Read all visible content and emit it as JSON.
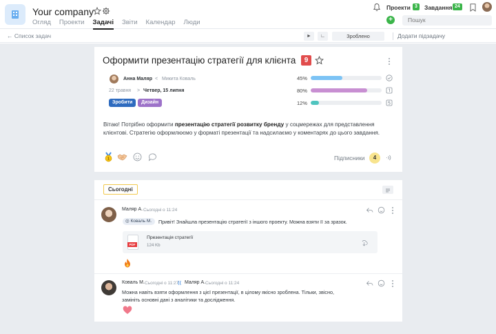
{
  "header": {
    "company": "Your company",
    "nav": [
      "Огляд",
      "Проекти",
      "Задачі",
      "Звіти",
      "Календар",
      "Люди"
    ],
    "active_nav": "Задачі",
    "projects_label": "Проекти",
    "projects_count": "3",
    "tasks_label": "Завдання",
    "tasks_count": "24",
    "search_placeholder": "Пошук"
  },
  "toolbar": {
    "back_label": "Список задач",
    "play_label": "►",
    "corner_label": "∟",
    "done_label": "Зроблено",
    "add_subtask_label": "Додати підзадачу"
  },
  "task": {
    "title": "Оформити презентацію стратегії для клієнта",
    "priority": "9",
    "assignee": "Анна Маляр",
    "arrow_left": "<",
    "watcher": "Микита Коваль",
    "start_date": "22 травня",
    "arrow_right": ">",
    "due_date": "Четвер, 15 липня",
    "progress": [
      {
        "percent": "45%",
        "value": 45,
        "color": "#7cc3f5",
        "icon": "check-circle"
      },
      {
        "percent": "80%",
        "value": 80,
        "color": "#c88fd2",
        "icon": "number-box-1"
      },
      {
        "percent": "12%",
        "value": 12,
        "color": "#4fc4bf",
        "icon": "number-box-5"
      }
    ],
    "tags": [
      {
        "label": "Зробити",
        "color": "#2e6bbf"
      },
      {
        "label": "Дизайн",
        "color": "#9d72c9"
      }
    ],
    "description": {
      "part1": "Вітаю! Потрібно оформити ",
      "bold": "презентацію стратегії розвитку бренду",
      "part2": " у соцмережах для представлення клієнтові. Стратегію оформлюємо у форматі презентації та надсилаємо у коментарях до цього завдання."
    },
    "subscribers_label": "Підписники",
    "subscribers_count": "4"
  },
  "comments_panel": {
    "today_label": "Сьогодні",
    "comments": [
      {
        "author": "Маляр А.",
        "time": "Сьогодні о 11:24",
        "mention": "Коваль М.",
        "text": "Привіт! Знайшла презентацію стратегії з іншого проекту. Можна взяти її за зразок.",
        "file_name": "Презентація стратегії",
        "file_size": "124 Kb",
        "file_type": "PDF",
        "reaction": "fire"
      },
      {
        "author": "Коваль М.",
        "time": "Сьогодні о 11:27",
        "reply_to": "Маляр А.",
        "reply_time": "Сьогодні о 11:24",
        "text_line1": "Можна навіть взяти оформлення з цієї презентації, в цілому якісно зроблена. Тільки, звісно,",
        "text_line2": "замініть основні дані з аналітики та дослідження.",
        "reaction": "heart"
      }
    ]
  }
}
